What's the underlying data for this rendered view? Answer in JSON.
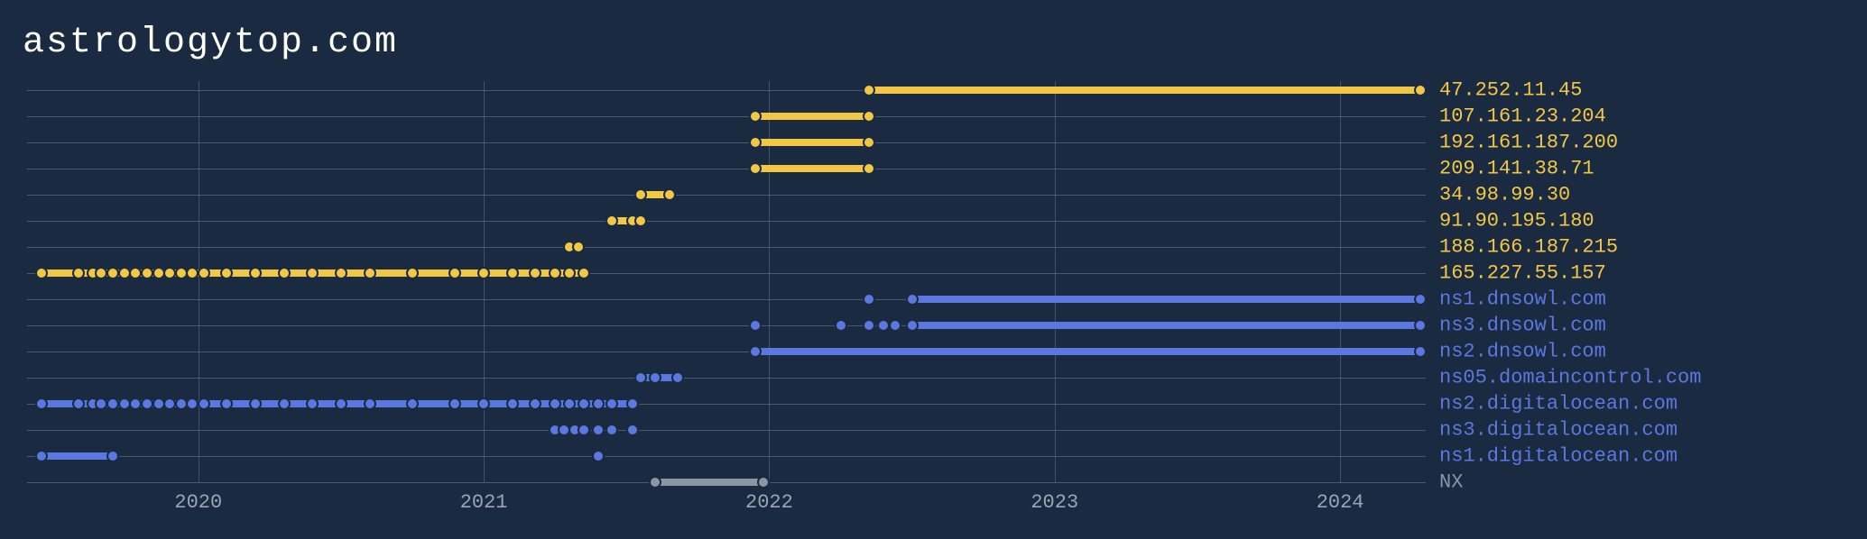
{
  "title": "astrologytop.com",
  "chart_data": {
    "type": "scatter",
    "xlabel": "",
    "ylabel": "",
    "xlim": [
      2019.4,
      2024.3
    ],
    "x_ticks": [
      2020,
      2021,
      2022,
      2023,
      2024
    ],
    "x_tick_labels": [
      "2020",
      "2021",
      "2022",
      "2023",
      "2024"
    ],
    "series": [
      {
        "name": "47.252.11.45",
        "group": "ip",
        "color": "#f2c744",
        "segments": [
          [
            2022.35,
            2024.28
          ]
        ],
        "points": [
          2022.35,
          2024.28
        ]
      },
      {
        "name": "107.161.23.204",
        "group": "ip",
        "color": "#f2c744",
        "segments": [
          [
            2021.95,
            2022.35
          ]
        ],
        "points": [
          2021.95,
          2022.35
        ]
      },
      {
        "name": "192.161.187.200",
        "group": "ip",
        "color": "#f2c744",
        "segments": [
          [
            2021.95,
            2022.35
          ]
        ],
        "points": [
          2021.95,
          2022.35
        ]
      },
      {
        "name": "209.141.38.71",
        "group": "ip",
        "color": "#f2c744",
        "segments": [
          [
            2021.95,
            2022.35
          ]
        ],
        "points": [
          2021.95,
          2022.35
        ]
      },
      {
        "name": "34.98.99.30",
        "group": "ip",
        "color": "#f2c744",
        "segments": [
          [
            2021.55,
            2021.65
          ]
        ],
        "points": [
          2021.55,
          2021.65
        ]
      },
      {
        "name": "91.90.195.180",
        "group": "ip",
        "color": "#f2c744",
        "segments": [
          [
            2021.45,
            2021.55
          ]
        ],
        "points": [
          2021.45,
          2021.52,
          2021.55
        ]
      },
      {
        "name": "188.166.187.215",
        "group": "ip",
        "color": "#f2c744",
        "segments": [],
        "points": [
          2021.3,
          2021.33
        ]
      },
      {
        "name": "165.227.55.157",
        "group": "ip",
        "color": "#f2c744",
        "segments": [
          [
            2019.45,
            2021.35
          ]
        ],
        "points": [
          2019.45,
          2019.58,
          2019.63,
          2019.66,
          2019.7,
          2019.74,
          2019.78,
          2019.82,
          2019.86,
          2019.9,
          2019.94,
          2019.98,
          2020.02,
          2020.1,
          2020.2,
          2020.3,
          2020.4,
          2020.5,
          2020.6,
          2020.75,
          2020.9,
          2021.0,
          2021.1,
          2021.18,
          2021.25,
          2021.3,
          2021.35
        ]
      },
      {
        "name": "ns1.dnsowl.com",
        "group": "ns",
        "color": "#5a78e0",
        "segments": [
          [
            2022.5,
            2024.28
          ]
        ],
        "points": [
          2022.35,
          2022.5,
          2024.28
        ]
      },
      {
        "name": "ns3.dnsowl.com",
        "group": "ns",
        "color": "#5a78e0",
        "segments": [
          [
            2022.5,
            2024.28
          ]
        ],
        "points": [
          2021.95,
          2022.25,
          2022.35,
          2022.4,
          2022.44,
          2022.5,
          2024.28
        ]
      },
      {
        "name": "ns2.dnsowl.com",
        "group": "ns",
        "color": "#5a78e0",
        "segments": [
          [
            2021.95,
            2024.28
          ]
        ],
        "points": [
          2021.95,
          2024.28
        ]
      },
      {
        "name": "ns05.domaincontrol.com",
        "group": "ns",
        "color": "#5a78e0",
        "segments": [
          [
            2021.55,
            2021.68
          ]
        ],
        "points": [
          2021.55,
          2021.6,
          2021.68
        ]
      },
      {
        "name": "ns2.digitalocean.com",
        "group": "ns",
        "color": "#5a78e0",
        "segments": [
          [
            2019.45,
            2021.52
          ]
        ],
        "points": [
          2019.45,
          2019.58,
          2019.63,
          2019.66,
          2019.7,
          2019.74,
          2019.78,
          2019.82,
          2019.86,
          2019.9,
          2019.94,
          2019.98,
          2020.02,
          2020.1,
          2020.2,
          2020.3,
          2020.4,
          2020.5,
          2020.6,
          2020.75,
          2020.9,
          2021.0,
          2021.1,
          2021.18,
          2021.25,
          2021.3,
          2021.35,
          2021.4,
          2021.45,
          2021.52
        ]
      },
      {
        "name": "ns3.digitalocean.com",
        "group": "ns",
        "color": "#5a78e0",
        "segments": [],
        "points": [
          2021.25,
          2021.28,
          2021.32,
          2021.35,
          2021.4,
          2021.45,
          2021.52
        ]
      },
      {
        "name": "ns1.digitalocean.com",
        "group": "ns",
        "color": "#5a78e0",
        "segments": [
          [
            2019.45,
            2019.7
          ]
        ],
        "points": [
          2019.45,
          2019.7,
          2021.4
        ]
      },
      {
        "name": "NX",
        "group": "nx",
        "color": "#8a96a6",
        "segments": [
          [
            2021.6,
            2021.98
          ]
        ],
        "points": [
          2021.6,
          2021.98
        ]
      }
    ]
  }
}
